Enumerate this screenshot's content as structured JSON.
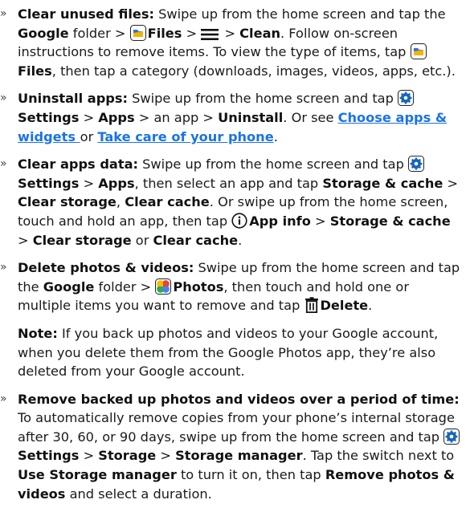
{
  "bullet_glyph": "»",
  "items": {
    "clear_files": {
      "t1": "Clear unused files:",
      "t2": " Swipe up from the home screen and tap the ",
      "t3": "Google",
      "t4": " folder > ",
      "t5": "Files",
      "t6": " > ",
      "t7": " > ",
      "t8": "Clean",
      "t9": ". Follow on-screen instructions to remove items. To view the type of items, tap ",
      "t10": "Files",
      "t11": ", then tap a category (downloads, images, videos, apps, etc.)."
    },
    "uninstall": {
      "t1": "Uninstall apps:",
      "t2": " Swipe up from the home screen and tap ",
      "t3": "Settings",
      "t4": " > ",
      "t5": "Apps",
      "t6": " > an app > ",
      "t7": "Uninstall",
      "t8": ". Or see ",
      "link1": "Choose apps & widgets ",
      "t9": "or ",
      "link2": "Take care of your phone",
      "t10": "."
    },
    "clear_data": {
      "t1": "Clear apps data:",
      "t2": " Swipe up from the home screen and tap ",
      "t3": "Settings",
      "t4": " > ",
      "t5": "Apps",
      "t6": ", then select an app and tap ",
      "t7": "Storage & cache",
      "t8": " > ",
      "t9": "Clear storage",
      "t10": ", ",
      "t11": "Clear cache",
      "t12": ". Or swipe up from the home screen, touch and hold an app, then tap ",
      "t13": "App info",
      "t14": " > ",
      "t15": "Storage & cache",
      "t16": " > ",
      "t17": "Clear storage",
      "t18": " or ",
      "t19": "Clear cache",
      "t20": "."
    },
    "delete_photos": {
      "t1": "Delete photos & videos:",
      "t2": " Swipe up from the home screen and tap the ",
      "t3": "Google",
      "t4": " folder > ",
      "t5": "Photos",
      "t6": ", then touch and hold one or multiple items you want to remove and tap ",
      "t7": "Delete",
      "t8": "."
    },
    "note": {
      "label": "Note:",
      "text": " If you back up photos and videos to your Google account, when you delete them from the Google Photos app, they’re also deleted from your Google account."
    },
    "remove_backed": {
      "t1": "Remove backed up photos and videos over a period of time:",
      "t2": " To automatically remove copies from your phone’s internal storage after 30, 60, or 90 days, swipe up from the home screen and tap ",
      "t3": "Settings",
      "t4": " > ",
      "t5": "Storage",
      "t6": " > ",
      "t7": "Storage manager",
      "t8": ". Tap the switch next to ",
      "t9": "Use Storage manager",
      "t10": " to turn it on, then tap ",
      "t11": "Remove photos & videos",
      "t12": " and select a duration."
    }
  },
  "icons": {
    "files": "files-app-icon",
    "menu": "menu-icon",
    "settings": "settings-app-icon",
    "info": "info-icon",
    "photos": "photos-app-icon",
    "delete": "trash-icon"
  },
  "colors": {
    "link": "#1a73e8",
    "settings_icon": "#1565c0"
  }
}
